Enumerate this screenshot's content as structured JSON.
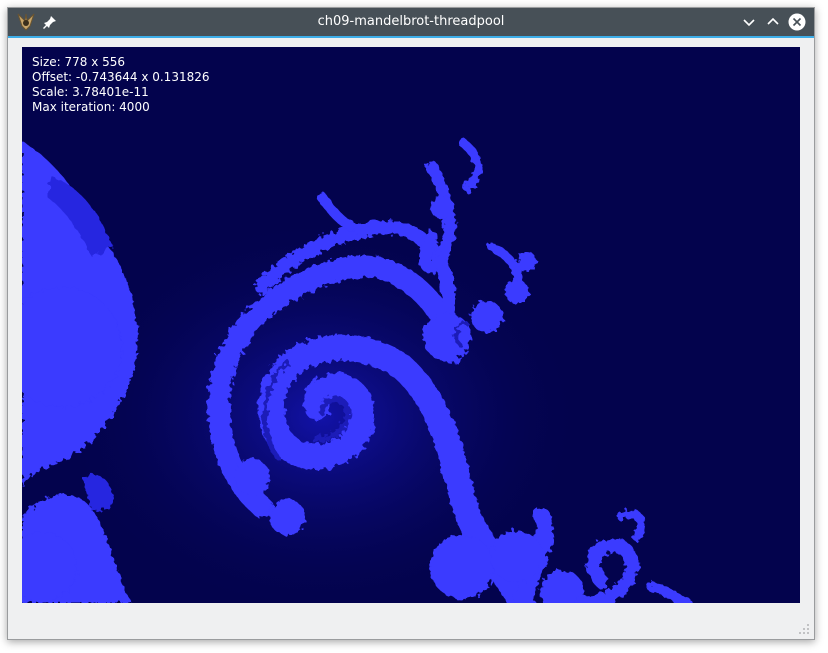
{
  "window": {
    "title": "ch09-mandelbrot-threadpool"
  },
  "icons": {
    "app": "kde-app-icon",
    "pin": "pin-icon",
    "minimize": "chevron-down-icon",
    "maximize": "chevron-up-icon",
    "close": "close-icon",
    "grip": "resize-grip-icon"
  },
  "info": {
    "size": "Size: 778 x 556",
    "offset": "Offset: -0.743644 x 0.131826",
    "scale": "Scale: 3.78401e-11",
    "max_iteration": "Max iteration: 4000"
  },
  "colors": {
    "titlebar": "#475057",
    "accent": "#3daee9",
    "background_fractal": "#03034d",
    "fractal_bright": "#3a3aff",
    "fractal_mid": "#2121c8"
  }
}
